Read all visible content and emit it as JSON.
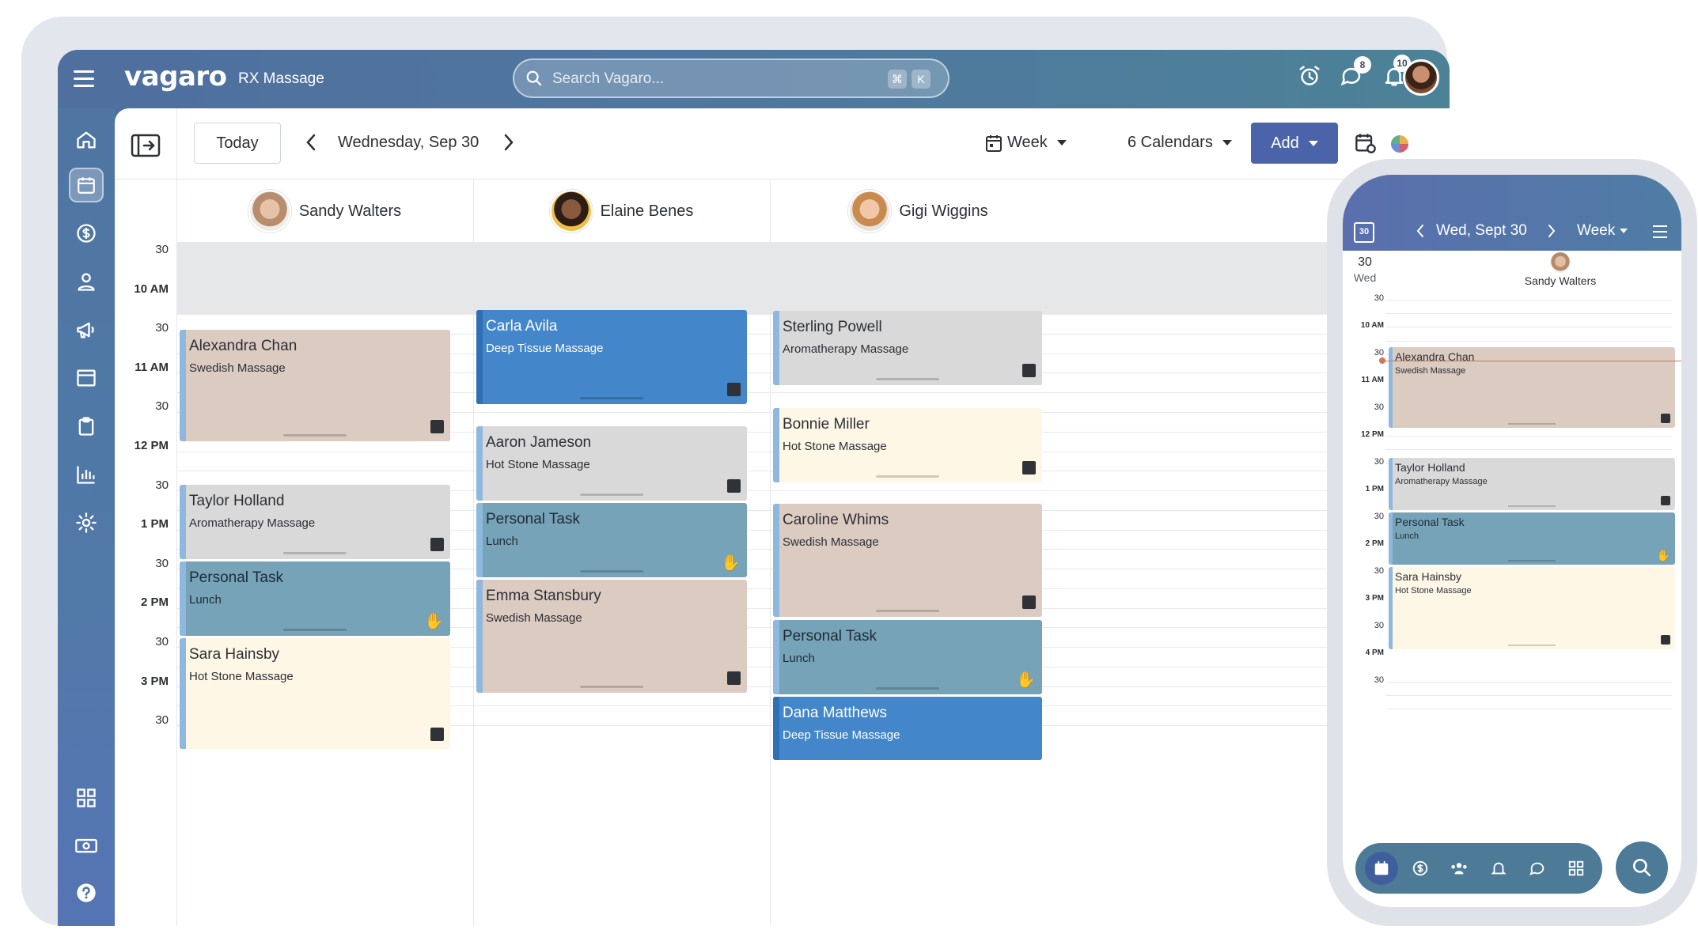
{
  "app": {
    "logo": "vagaro",
    "business": "RX Massage"
  },
  "search": {
    "placeholder": "Search Vagaro...",
    "key1": "⌘",
    "key2": "K"
  },
  "badges": {
    "messages": "8",
    "notifications": "10"
  },
  "toolbar": {
    "today": "Today",
    "date": "Wednesday, Sep 30",
    "view": "Week",
    "calendars": "6 Calendars",
    "add": "Add"
  },
  "staff": [
    {
      "name": "Sandy Walters"
    },
    {
      "name": "Elaine Benes"
    },
    {
      "name": "Gigi Wiggins"
    }
  ],
  "times": [
    "30",
    "10 AM",
    "30",
    "11 AM",
    "30",
    "12 PM",
    "30",
    "1 PM",
    "30",
    "2 PM",
    "30",
    "3 PM",
    "30"
  ],
  "appointments": {
    "sandy": [
      {
        "name": "Alexandra Chan",
        "service": "Swedish Massage"
      },
      {
        "name": "Taylor Holland",
        "service": "Aromatherapy Massage"
      },
      {
        "name": "Personal Task",
        "service": "Lunch"
      },
      {
        "name": "Sara Hainsby",
        "service": "Hot Stone Massage"
      }
    ],
    "elaine": [
      {
        "name": "Carla Avila",
        "service": "Deep Tissue Massage"
      },
      {
        "name": "Aaron Jameson",
        "service": "Hot Stone Massage"
      },
      {
        "name": "Personal Task",
        "service": "Lunch"
      },
      {
        "name": "Emma Stansbury",
        "service": "Swedish Massage"
      }
    ],
    "gigi": [
      {
        "name": "Sterling Powell",
        "service": "Aromatherapy Massage"
      },
      {
        "name": "Bonnie Miller",
        "service": "Hot Stone Massage"
      },
      {
        "name": "Caroline Whims",
        "service": "Swedish Massage"
      },
      {
        "name": "Personal Task",
        "service": "Lunch"
      },
      {
        "name": "Dana Matthews",
        "service": "Deep Tissue Massage"
      }
    ]
  },
  "phone": {
    "date": "Wed, Sept 30",
    "view": "Week",
    "calendar_icon_day": "30",
    "day_num": "30",
    "day_name": "Wed",
    "staff": "Sandy Walters",
    "times": [
      "30",
      "10 AM",
      "30",
      "11 AM",
      "30",
      "12 PM",
      "30",
      "1 PM",
      "30",
      "2 PM",
      "30",
      "3 PM",
      "30",
      "4 PM",
      "30"
    ],
    "appointments": [
      {
        "name": "Alexandra Chan",
        "service": "Swedish Massage"
      },
      {
        "name": "Taylor Holland",
        "service": "Aromatherapy Massage"
      },
      {
        "name": "Personal Task",
        "service": "Lunch"
      },
      {
        "name": "Sara Hainsby",
        "service": "Hot Stone Massage"
      }
    ]
  },
  "colors": {
    "tan": "#dccbc1",
    "grey": "#d9d9da",
    "cream": "#fff7e6",
    "teal": "#76a3b7",
    "blue": "#4386c9",
    "accent": "#4b63a8"
  }
}
